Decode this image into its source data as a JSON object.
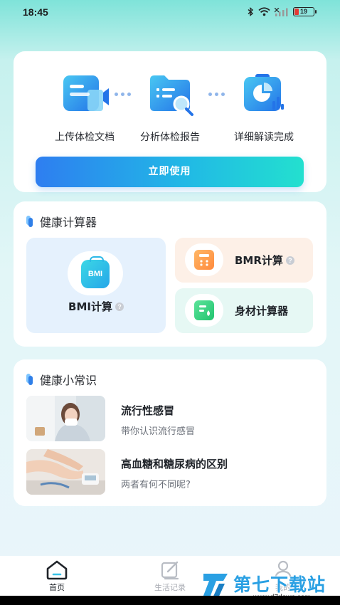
{
  "status_bar": {
    "time": "18:45",
    "battery_level": "19",
    "icons": [
      "bluetooth-icon",
      "wifi-icon",
      "signal-icon",
      "battery-icon"
    ]
  },
  "upload_card": {
    "steps": [
      {
        "label": "上传体检文档",
        "icon": "upload-document-icon"
      },
      {
        "label": "分析体检报告",
        "icon": "analyze-folder-icon"
      },
      {
        "label": "详细解读完成",
        "icon": "report-chart-icon"
      }
    ],
    "button_label": "立即使用"
  },
  "calculators": {
    "title": "健康计算器",
    "bmi": {
      "badge_text": "BMI",
      "label": "BMI计算",
      "help": "?"
    },
    "bmr": {
      "label": "BMR计算",
      "help": "?"
    },
    "body": {
      "label": "身材计算器"
    }
  },
  "knowledge": {
    "title": "健康小常识",
    "articles": [
      {
        "title": "流行性感冒",
        "subtitle": "带你认识流行感冒"
      },
      {
        "title": "高血糖和糖尿病的区别",
        "subtitle": "两者有何不同呢?"
      }
    ]
  },
  "bottom_nav": {
    "items": [
      {
        "label": "首页",
        "icon": "home-icon",
        "active": true
      },
      {
        "label": "生活记录",
        "icon": "edit-record-icon",
        "active": false
      },
      {
        "label": "我的",
        "icon": "profile-icon",
        "active": false
      }
    ]
  },
  "watermark": {
    "text": "第七下载站",
    "url": "www.d7down.com"
  },
  "colors": {
    "accent_blue": "#2e7ef0",
    "accent_cyan": "#23e0cf",
    "bmr_tile": "#fdf0e7",
    "body_tile": "#e6f8f4",
    "bmi_tile": "#e5f1fd"
  }
}
